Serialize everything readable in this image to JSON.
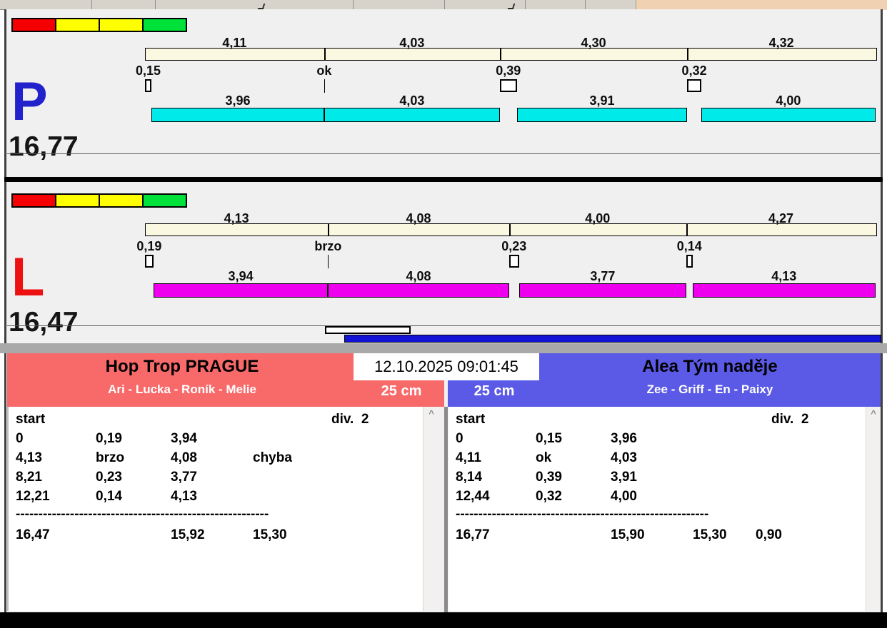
{
  "flags": {
    "colors": [
      "#f40000",
      "#ffff00",
      "#ffff00",
      "#00e23a"
    ]
  },
  "lanes": [
    {
      "id": "P",
      "label": "P",
      "letter_color": "#2222cc",
      "total": "16,77",
      "bar_color": "#00eaea",
      "legs": [
        {
          "total": "4,11",
          "gap": "0,15",
          "clean": "3,96"
        },
        {
          "total": "4,03",
          "gap": "ok",
          "clean": "4,03"
        },
        {
          "total": "4,30",
          "gap": "0,39",
          "clean": "3,91"
        },
        {
          "total": "4,32",
          "gap": "0,32",
          "clean": "4,00"
        }
      ]
    },
    {
      "id": "L",
      "label": "L",
      "letter_color": "#ee1111",
      "total": "16,47",
      "bar_color": "#ee00ee",
      "legs": [
        {
          "total": "4,13",
          "gap": "0,19",
          "clean": "3,94"
        },
        {
          "total": "4,08",
          "gap": "brzo",
          "clean": "4,08"
        },
        {
          "total": "4,00",
          "gap": "0,23",
          "clean": "3,77"
        },
        {
          "total": "4,27",
          "gap": "0,14",
          "clean": "4,13"
        }
      ]
    }
  ],
  "clock": {
    "datetime": "12.10.2025 09:01:45"
  },
  "teams": [
    {
      "side": "left",
      "name": "Hop Trop PRAGUE",
      "members": "Ari - Lucka - Roník - Melie",
      "rope_height": "25 cm",
      "header_color": "#f86a6a",
      "table": {
        "start_label": "start",
        "division_label": "div.  2",
        "rows": [
          [
            "0",
            "0,19",
            "3,94",
            ""
          ],
          [
            "4,13",
            "brzo",
            "4,08",
            "chyba"
          ],
          [
            "8,21",
            "0,23",
            "3,77",
            ""
          ],
          [
            "12,21",
            "0,14",
            "4,13",
            ""
          ]
        ],
        "separator": "--------------------------------------------------------",
        "summary": [
          "16,47",
          "",
          "15,92",
          "15,30",
          ""
        ]
      }
    },
    {
      "side": "right",
      "name": "Alea Tým naděje",
      "members": "Zee - Griff - En - Paixy",
      "rope_height": "25 cm",
      "header_color": "#5a5ae6",
      "table": {
        "start_label": "start",
        "division_label": "div.  2",
        "rows": [
          [
            "0",
            "0,15",
            "3,96",
            ""
          ],
          [
            "4,11",
            "ok",
            "4,03",
            ""
          ],
          [
            "8,14",
            "0,39",
            "3,91",
            ""
          ],
          [
            "12,44",
            "0,32",
            "4,00",
            ""
          ]
        ],
        "separator": "--------------------------------------------------------",
        "summary": [
          "16,77",
          "",
          "15,90",
          "15,30",
          "0,90"
        ]
      }
    }
  ]
}
